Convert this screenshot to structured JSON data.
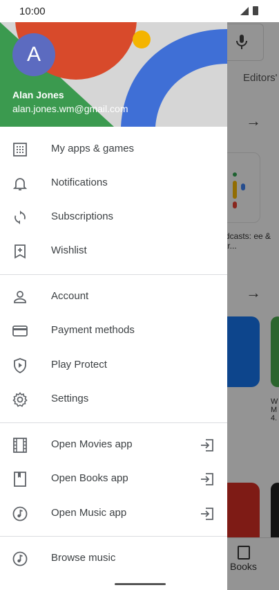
{
  "status": {
    "time": "10:00"
  },
  "background": {
    "tab_label": "Editors'",
    "podcasts_label": "dcasts: ee & tr...",
    "whatsapp_label": "W M 4.",
    "bottom_nav_label": "Books"
  },
  "drawer": {
    "user": {
      "initial": "A",
      "name": "Alan Jones",
      "email": "alan.jones.wm@gmail.com"
    },
    "items": [
      {
        "label": "My apps & games",
        "icon": "apps-grid-icon"
      },
      {
        "label": "Notifications",
        "icon": "bell-icon"
      },
      {
        "label": "Subscriptions",
        "icon": "refresh-icon"
      },
      {
        "label": "Wishlist",
        "icon": "bookmark-add-icon"
      },
      {
        "label": "Account",
        "icon": "person-icon"
      },
      {
        "label": "Payment methods",
        "icon": "credit-card-icon"
      },
      {
        "label": "Play Protect",
        "icon": "shield-play-icon"
      },
      {
        "label": "Settings",
        "icon": "gear-icon"
      },
      {
        "label": "Open Movies app",
        "icon": "film-icon"
      },
      {
        "label": "Open Books app",
        "icon": "book-icon"
      },
      {
        "label": "Open Music app",
        "icon": "music-note-icon"
      },
      {
        "label": "Browse music",
        "icon": "music-note-icon"
      }
    ]
  }
}
